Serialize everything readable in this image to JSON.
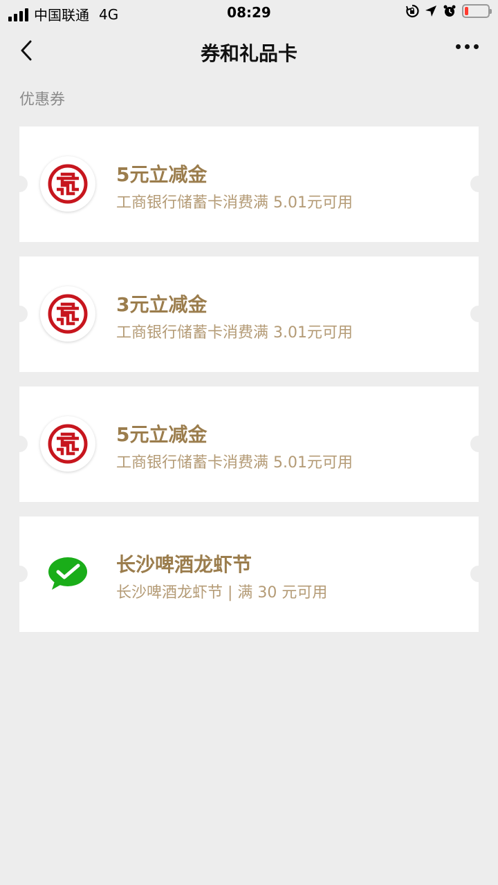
{
  "status_bar": {
    "carrier": "中国联通",
    "network": "4G",
    "time": "08:29",
    "battery_level": 0.15,
    "icons": [
      "signal-icon",
      "rotation-lock-icon",
      "location-arrow-icon",
      "alarm-icon",
      "battery-icon"
    ]
  },
  "nav": {
    "back_icon": "chevron-left-icon",
    "title": "券和礼品卡",
    "more_icon": "more-dots-icon"
  },
  "section": {
    "label": "优惠券"
  },
  "coupons": [
    {
      "title": "5元立减金",
      "desc": "工商银行储蓄卡消费满 5.01元可用",
      "logo": "icbc-logo-icon"
    },
    {
      "title": "3元立减金",
      "desc": "工商银行储蓄卡消费满 3.01元可用",
      "logo": "icbc-logo-icon"
    },
    {
      "title": "5元立减金",
      "desc": "工商银行储蓄卡消费满 5.01元可用",
      "logo": "icbc-logo-icon"
    },
    {
      "title": "长沙啤酒龙虾节",
      "desc": "长沙啤酒龙虾节 | 满 30 元可用",
      "logo": "wechat-pay-logo-icon"
    }
  ],
  "colors": {
    "background": "#ededed",
    "coupon_title": "#9b7d4d",
    "coupon_desc": "#b49b76",
    "icbc_red": "#c7161e",
    "wechat_green": "#1aad19"
  }
}
